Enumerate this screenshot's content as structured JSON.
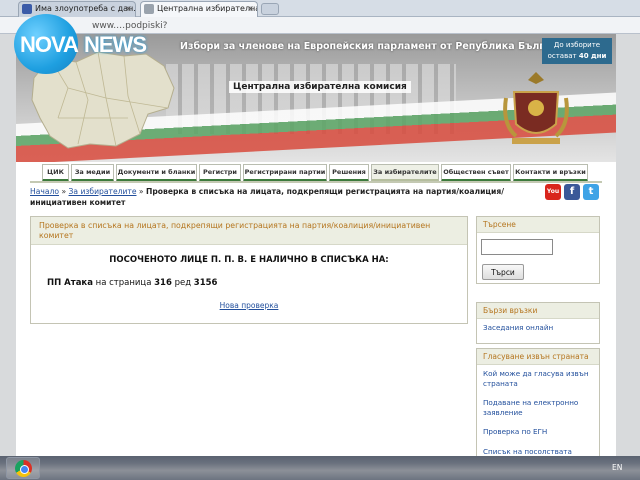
{
  "browser": {
    "tabs": [
      {
        "title": "Има злоупотреба с дан…",
        "active": false
      },
      {
        "title": "Централна избирателна",
        "active": true
      }
    ],
    "address": "www.…podpiski?"
  },
  "logo": {
    "part1": "NOVA",
    "part2": "NEWS"
  },
  "banner": {
    "title": "Избори за членове на Европейския парламент от Република България",
    "commission": "Централна избирателна комисия",
    "countdown_line1": "До изборите",
    "countdown_line2": "остават",
    "countdown_days": "40 дни"
  },
  "nav": {
    "items": [
      {
        "label": "ЦИК"
      },
      {
        "label": "За медии"
      },
      {
        "label": "Документи и бланки"
      },
      {
        "label": "Регистри"
      },
      {
        "label": "Регистрирани партии"
      },
      {
        "label": "Решения"
      },
      {
        "label": "За избирателите",
        "active": true
      },
      {
        "label": "Обществен съвет"
      },
      {
        "label": "Контакти и връзки"
      }
    ]
  },
  "breadcrumb": {
    "home": "Начало",
    "section": "За избирателите",
    "current": "Проверка в списъка на лицата, подкрепящи регистрацията на партия/коалиция/инициативен комитет",
    "separator": "»"
  },
  "social": {
    "youtube": "You",
    "facebook": "f",
    "twitter": "t"
  },
  "main": {
    "header": "Проверка в списъка на лицата, подкрепящи регистрацията на партия/коалиция/инициативен комитет",
    "result_heading": "ПОСОЧЕНОТО ЛИЦЕ П. П. В. Е НАЛИЧНО В СПИСЪКА НА:",
    "party": "ПП Атака",
    "on_page": "на страница",
    "page_number": "316",
    "row_label": "ред",
    "row_number": "3156",
    "new_check": "Нова проверка"
  },
  "sidebar": {
    "search_title": "Търсене",
    "search_button": "Търси",
    "quick_links_title": "Бързи връзки",
    "quick_links": [
      "Заседания онлайн"
    ],
    "vote_abroad_title": "Гласуване извън страната",
    "vote_abroad_links": [
      "Кой може да гласува извън страната",
      "Подаване на електронно заявление",
      "Проверка по ЕГН",
      "Списък на посолствата"
    ]
  },
  "taskbar": {
    "language": "EN"
  },
  "colors": {
    "accent_header_text": "#b5751e",
    "link": "#224f9c",
    "nav_underline": "#3c7a3c",
    "logo_blue": "#1e9fe0",
    "countdown_bg": "#2d6a8e"
  }
}
